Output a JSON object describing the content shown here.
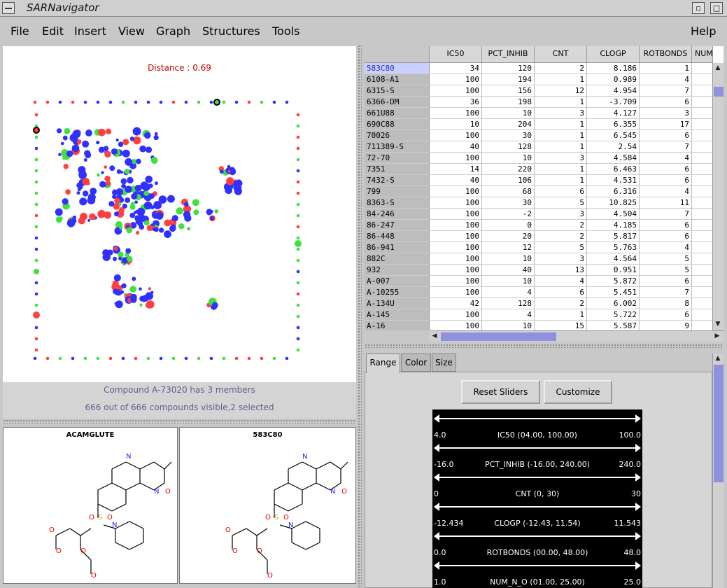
{
  "window": {
    "title": "SARNavigator"
  },
  "menu": [
    "File",
    "Edit",
    "Insert",
    "View",
    "Graph",
    "Structures",
    "Tools"
  ],
  "help": "Help",
  "plot": {
    "distance": "Distance : 0.69",
    "status1": "Compound A-73020 has 3 members",
    "status2": "666 out of 666 compounds visible,2 selected",
    "colors": {
      "red": "#ff4040",
      "green": "#40e040",
      "blue": "#3030ff"
    }
  },
  "structures": [
    {
      "name": "ACAMGLUTE"
    },
    {
      "name": "583C80"
    }
  ],
  "table": {
    "columns": [
      "IC50",
      "PCT_INHIB",
      "CNT",
      "CLOGP",
      "ROTBONDS",
      "NUM"
    ],
    "rows": [
      [
        "583C80",
        "34",
        "120",
        "2",
        "8.186",
        "1"
      ],
      [
        "6108-A1",
        "100",
        "194",
        "1",
        "0.989",
        "4"
      ],
      [
        "6315-S",
        "100",
        "156",
        "12",
        "4.954",
        "7"
      ],
      [
        "6366-DM",
        "36",
        "198",
        "1",
        "-3.709",
        "6"
      ],
      [
        "661U88",
        "100",
        "10",
        "3",
        "4.127",
        "3"
      ],
      [
        "690C88",
        "10",
        "204",
        "1",
        "6.355",
        "17"
      ],
      [
        "70026",
        "100",
        "30",
        "1",
        "6.545",
        "6"
      ],
      [
        "711389-S",
        "40",
        "128",
        "1",
        "2.54",
        "7"
      ],
      [
        "72-70",
        "100",
        "10",
        "3",
        "4.584",
        "4"
      ],
      [
        "7351",
        "14",
        "220",
        "1",
        "6.463",
        "6"
      ],
      [
        "7432-S",
        "40",
        "106",
        "1",
        "4.531",
        "6"
      ],
      [
        "799",
        "100",
        "68",
        "6",
        "6.316",
        "4"
      ],
      [
        "8363-S",
        "100",
        "30",
        "5",
        "10.825",
        "11"
      ],
      [
        "84-246",
        "100",
        "-2",
        "3",
        "4.504",
        "7"
      ],
      [
        "86-247",
        "100",
        "0",
        "2",
        "4.185",
        "6"
      ],
      [
        "86-448",
        "100",
        "20",
        "2",
        "5.817",
        "6"
      ],
      [
        "86-941",
        "100",
        "12",
        "5",
        "5.763",
        "4"
      ],
      [
        "882C",
        "100",
        "10",
        "3",
        "4.564",
        "5"
      ],
      [
        "932",
        "100",
        "40",
        "13",
        "0.951",
        "5"
      ],
      [
        "A-007",
        "100",
        "10",
        "4",
        "5.872",
        "6"
      ],
      [
        "A-10255",
        "100",
        "4",
        "6",
        "5.451",
        "7"
      ],
      [
        "A-134U",
        "42",
        "128",
        "2",
        "6.002",
        "8"
      ],
      [
        "A-145",
        "100",
        "4",
        "1",
        "5.722",
        "6"
      ],
      [
        "A-16",
        "100",
        "10",
        "15",
        "5.587",
        "9"
      ]
    ]
  },
  "tabs": [
    "Range",
    "Color",
    "Size"
  ],
  "buttons": {
    "reset": "Reset Sliders",
    "customize": "Customize"
  },
  "sliders": [
    {
      "lo": "4.0",
      "label": "IC50 (04.00, 100.00)",
      "hi": "100.0"
    },
    {
      "lo": "-16.0",
      "label": "PCT_INHIB (-16.00, 240.00)",
      "hi": "240.0"
    },
    {
      "lo": "0",
      "label": "CNT (0, 30)",
      "hi": "30"
    },
    {
      "lo": "-12.434",
      "label": "CLOGP (-12.43, 11.54)",
      "hi": "11.543"
    },
    {
      "lo": "0.0",
      "label": "ROTBONDS (00.00, 48.00)",
      "hi": "48.0"
    },
    {
      "lo": "1.0",
      "label": "NUM_N_O (01.00, 25.00)",
      "hi": "25.0"
    }
  ]
}
